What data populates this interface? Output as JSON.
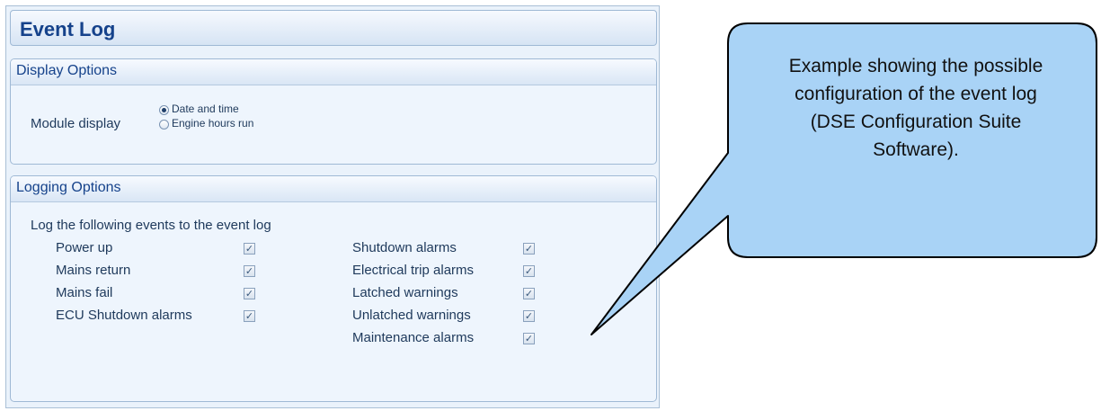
{
  "title": "Event Log",
  "display_options": {
    "header": "Display Options",
    "module_display_label": "Module display",
    "options": [
      {
        "label": "Date and time",
        "selected": true
      },
      {
        "label": "Engine hours run",
        "selected": false
      }
    ]
  },
  "logging_options": {
    "header": "Logging Options",
    "intro": "Log the following events to the event log",
    "left_items": [
      {
        "label": "Power up",
        "checked": true
      },
      {
        "label": "Mains return",
        "checked": true
      },
      {
        "label": "Mains fail",
        "checked": true
      },
      {
        "label": "ECU Shutdown alarms",
        "checked": true
      }
    ],
    "right_items": [
      {
        "label": "Shutdown alarms",
        "checked": true
      },
      {
        "label": "Electrical trip alarms",
        "checked": true
      },
      {
        "label": "Latched warnings",
        "checked": true
      },
      {
        "label": "Unlatched warnings",
        "checked": true
      },
      {
        "label": "Maintenance alarms",
        "checked": true
      }
    ]
  },
  "callout": {
    "lines": [
      "Example showing the possible",
      "configuration of the event log",
      "(DSE Configuration Suite",
      "Software)."
    ],
    "fill": "#a9d3f6",
    "stroke": "#000000"
  },
  "colors": {
    "title": "#15428b",
    "panel_bg": "#eaf2fb",
    "text": "#1e395b"
  }
}
